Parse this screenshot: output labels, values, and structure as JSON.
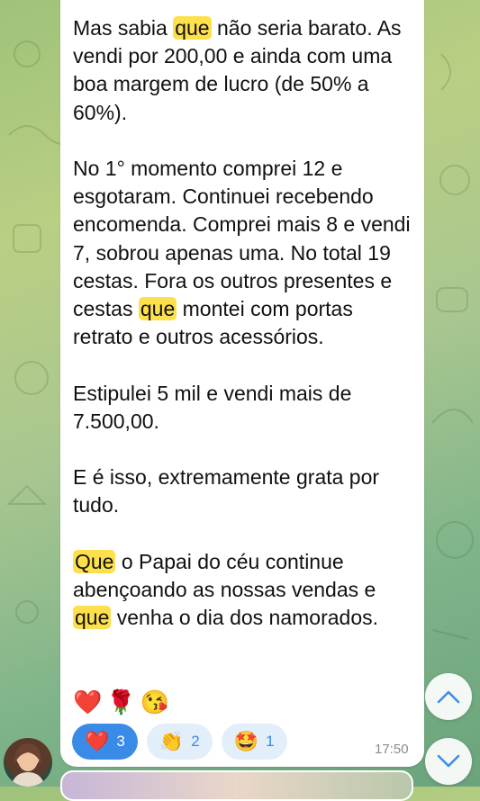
{
  "message": {
    "paragraphs": [
      [
        {
          "text": "Mas sabia "
        },
        {
          "text": "que",
          "hl": true
        },
        {
          "text": " não seria barato. As vendi por 200,00 e ainda com uma boa margem de lucro (de 50% a 60%)."
        }
      ],
      [
        {
          "text": "No 1° momento comprei 12 e esgotaram. Continuei recebendo encomenda. Comprei mais 8 e vendi 7, sobrou apenas uma. No total 19 cestas. Fora os outros presentes e cestas "
        },
        {
          "text": "que",
          "hl": true
        },
        {
          "text": " montei com portas retrato e outros acessórios."
        }
      ],
      [
        {
          "text": "Estipulei 5 mil e vendi mais de 7.500,00."
        }
      ],
      [
        {
          "text": "E é isso, extremamente grata por tudo."
        }
      ],
      [
        {
          "text": "Que",
          "hl": true
        },
        {
          "text": " o Papai do céu continue abençoando as nossas vendas e "
        },
        {
          "text": "que",
          "hl": true
        },
        {
          "text": " venha o dia dos namorados."
        }
      ]
    ],
    "emojis": [
      "❤️",
      "🌹",
      "😘"
    ],
    "reactions": [
      {
        "emoji": "❤️",
        "count": "3",
        "active": true
      },
      {
        "emoji": "👏",
        "count": "2",
        "active": false
      },
      {
        "emoji": "🤩",
        "count": "1",
        "active": false
      }
    ],
    "time": "17:50"
  },
  "colors": {
    "highlight": "#fde04b",
    "accent": "#3a8ae8"
  },
  "icons": {
    "scroll_up": "chevron-up-icon",
    "scroll_down": "chevron-down-icon"
  }
}
